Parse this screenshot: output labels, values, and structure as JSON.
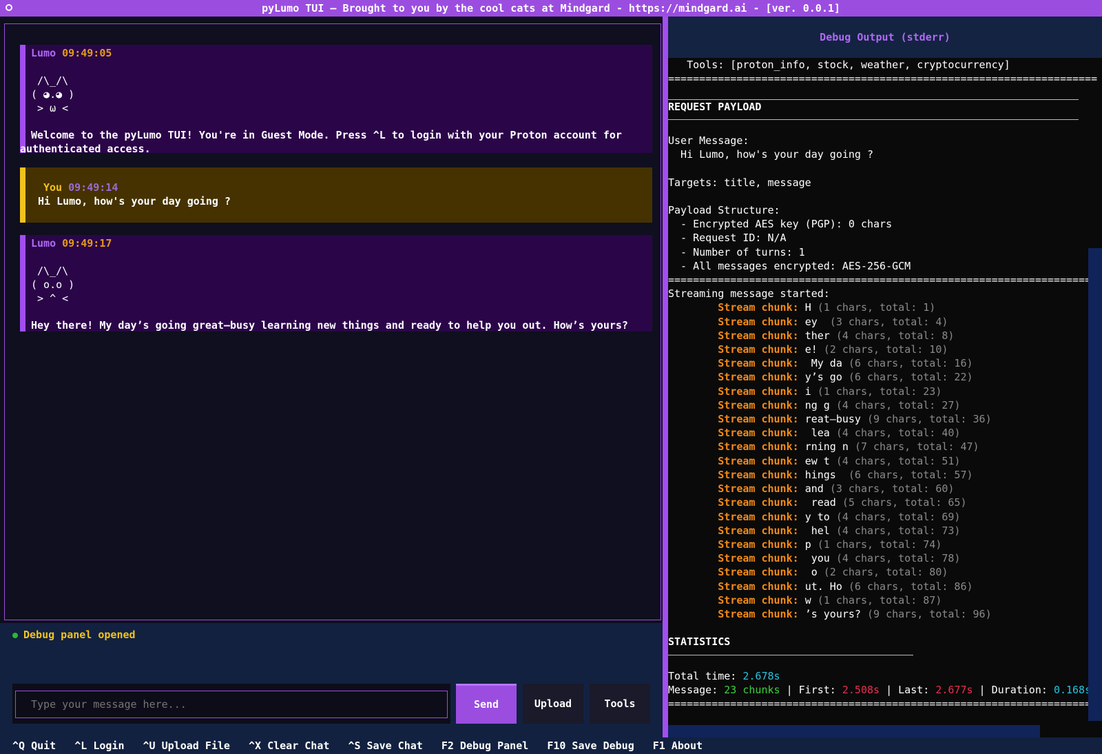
{
  "title": "pyLumo TUI — Brought to you by the cool cats at Mindgard - https://mindgard.ai - [ver. 0.0.1]",
  "messages": [
    {
      "who": "Lumo",
      "time": "09:49:05",
      "art": " /\\_/\\\n( ◕.◕ )\n > ω <",
      "text": "Welcome to the pyLumo TUI! You're in Guest Mode. Press ^L to login with your Proton account for",
      "text2": "authenticated access."
    },
    {
      "who": "You",
      "time": "09:49:14",
      "text": "Hi Lumo, how's your day going ?"
    },
    {
      "who": "Lumo",
      "time": "09:49:17",
      "art": " /\\_/\\\n( o.o )\n > ^ <",
      "text": "Hey there! My day’s going great—busy learning new things and ready to help you out. How’s yours?"
    }
  ],
  "status": "Debug panel opened",
  "input": {
    "placeholder": "Type your message here..."
  },
  "buttons": {
    "send": "Send",
    "upload": "Upload",
    "tools": "Tools"
  },
  "footer": [
    "^Q Quit",
    "^L Login",
    "^U Upload File",
    "^X Clear Chat",
    "^S Save Chat",
    "F2 Debug Panel",
    "F10 Save Debug",
    "F1 About"
  ],
  "debug": {
    "header": "Debug Output (stderr)",
    "tools_line": "   Tools: [proton_info, stock, weather, cryptocurrency]",
    "sep": "=====================================================================",
    "request_title": "REQUEST PAYLOAD",
    "user_message_label": "User Message:",
    "user_message": "  Hi Lumo, how's your day going ?",
    "targets": "Targets: title, message",
    "payload_label": "Payload Structure:",
    "payload_items": [
      "  - Encrypted AES key (PGP): 0 chars",
      "  - Request ID: N/A",
      "  - Number of turns: 1",
      "  - All messages encrypted: AES-256-GCM"
    ],
    "stream_started": "Streaming message started:",
    "chunk_label": "Stream chunk:",
    "chunks": [
      {
        "text": "H",
        "info": "(1 chars, total: 1)"
      },
      {
        "text": "ey",
        "info": " (3 chars, total: 4)"
      },
      {
        "text": "ther",
        "info": "(4 chars, total: 8)"
      },
      {
        "text": "e!",
        "info": "(2 chars, total: 10)"
      },
      {
        "text": " My da",
        "info": "(6 chars, total: 16)"
      },
      {
        "text": "y’s go",
        "info": "(6 chars, total: 22)"
      },
      {
        "text": "i",
        "info": "(1 chars, total: 23)"
      },
      {
        "text": "ng g",
        "info": "(4 chars, total: 27)"
      },
      {
        "text": "reat—busy",
        "info": "(9 chars, total: 36)"
      },
      {
        "text": " lea",
        "info": "(4 chars, total: 40)"
      },
      {
        "text": "rning n",
        "info": "(7 chars, total: 47)"
      },
      {
        "text": "ew t",
        "info": "(4 chars, total: 51)"
      },
      {
        "text": "hings ",
        "info": "(6 chars, total: 57)"
      },
      {
        "text": "and",
        "info": "(3 chars, total: 60)"
      },
      {
        "text": " read",
        "info": "(5 chars, total: 65)"
      },
      {
        "text": "y to",
        "info": "(4 chars, total: 69)"
      },
      {
        "text": " hel",
        "info": "(4 chars, total: 73)"
      },
      {
        "text": "p",
        "info": "(1 chars, total: 74)"
      },
      {
        "text": " you",
        "info": "(4 chars, total: 78)"
      },
      {
        "text": " o",
        "info": "(2 chars, total: 80)"
      },
      {
        "text": "ut. Ho",
        "info": "(6 chars, total: 86)"
      },
      {
        "text": "w",
        "info": "(1 chars, total: 87)"
      },
      {
        "text": "’s yours?",
        "info": "(9 chars, total: 96)"
      }
    ],
    "statistics_title": "STATISTICS",
    "total_time_label": "Total time: ",
    "total_time": "2.678s",
    "message_label": "Message: ",
    "chunks_count": "23 chunks",
    "first_label": " | First: ",
    "first": "2.508s",
    "last_label": " | Last: ",
    "last": "2.677s",
    "duration_label": " | Duration: ",
    "duration": "0.168s"
  }
}
